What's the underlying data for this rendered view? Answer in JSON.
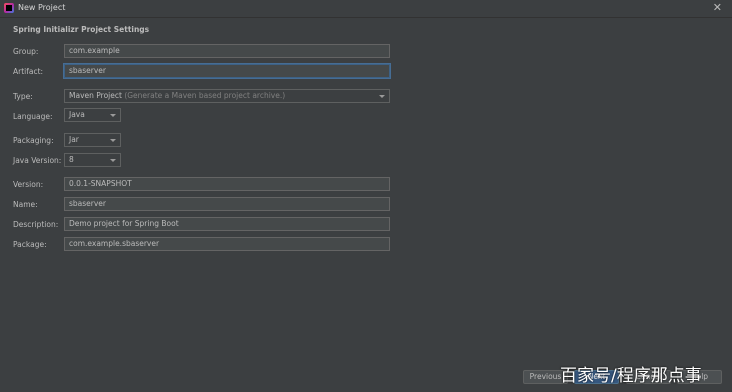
{
  "window": {
    "title": "New Project"
  },
  "section_title": "Spring Initializr Project Settings",
  "fields": {
    "group": {
      "label": "Group:",
      "value": "com.example"
    },
    "artifact": {
      "label": "Artifact:",
      "value": "sbaserver"
    },
    "type": {
      "label": "Type:",
      "value": "Maven Project",
      "hint": "(Generate a Maven based project archive.)"
    },
    "language": {
      "label": "Language:",
      "value": "Java"
    },
    "packaging": {
      "label": "Packaging:",
      "value": "Jar"
    },
    "java_version": {
      "label": "Java Version:",
      "value": "8"
    },
    "version": {
      "label": "Version:",
      "value": "0.0.1-SNAPSHOT"
    },
    "name": {
      "label": "Name:",
      "value": "sbaserver"
    },
    "description": {
      "label": "Description:",
      "value": "Demo project for Spring Boot"
    },
    "package": {
      "label": "Package:",
      "value": "com.example.sbaserver"
    }
  },
  "buttons": {
    "previous": "Previous",
    "next": "Next",
    "cancel": "Cancel",
    "help": "Help"
  },
  "watermark": "百家号/程序那点事"
}
